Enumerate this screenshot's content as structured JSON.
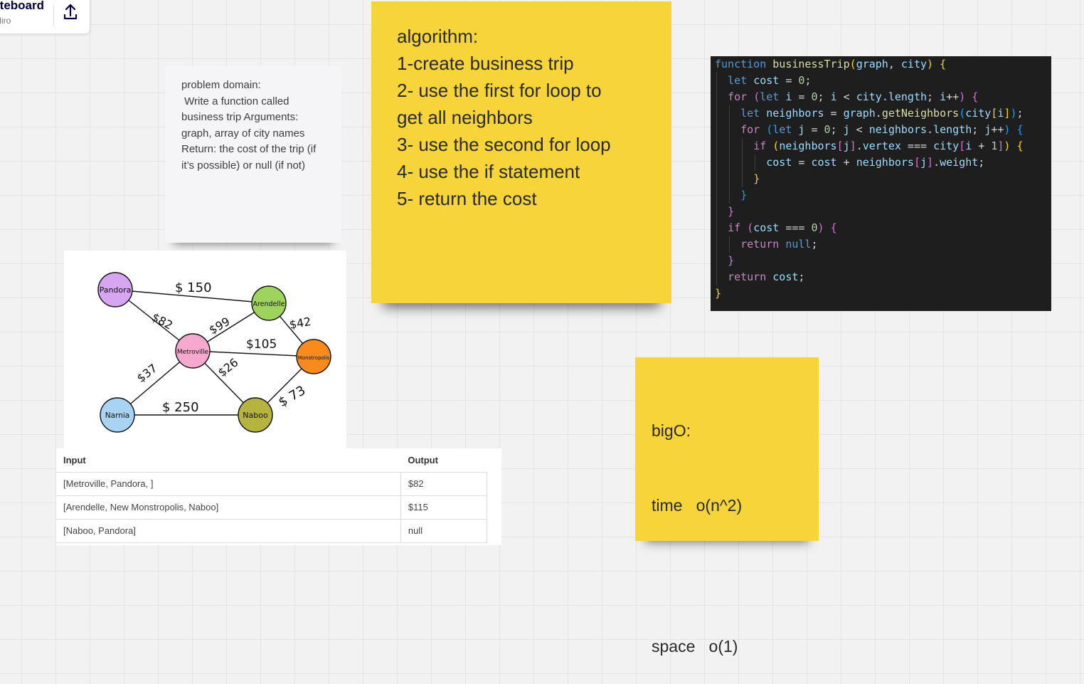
{
  "header": {
    "title": "Whiteboard",
    "subtitle": "Miro"
  },
  "notes": {
    "problem": "problem domain:\n Write a function called business trip Arguments: graph, array of city names\nReturn: the cost of the trip (if it’s possible) or null (if not)",
    "algorithm": [
      "algorithm:",
      "1-create business trip",
      "2- use the first for loop to",
      "get all neighbors",
      "3- use the second for loop",
      "4- use the if statement",
      "5- return the cost"
    ],
    "bigo": [
      "bigO:",
      "time   o(n^2)",
      "",
      "space   o(1)"
    ]
  },
  "graph": {
    "nodes": [
      {
        "id": "pandora",
        "label": "Pandora",
        "color": "#d6a6f2"
      },
      {
        "id": "arendelle",
        "label": "Arendelle",
        "color": "#9ed35d"
      },
      {
        "id": "metroville",
        "label": "Metroville",
        "color": "#f6a8cf"
      },
      {
        "id": "monstropolis",
        "label": "Monstropolis",
        "color": "#f98a1c"
      },
      {
        "id": "narnia",
        "label": "Narnia",
        "color": "#a9d3f3"
      },
      {
        "id": "naboo",
        "label": "Naboo",
        "color": "#b5b440"
      }
    ],
    "edges": [
      {
        "from": "pandora",
        "to": "arendelle",
        "label": "$ 150"
      },
      {
        "from": "pandora",
        "to": "metroville",
        "label": "$82"
      },
      {
        "from": "metroville",
        "to": "arendelle",
        "label": "$99"
      },
      {
        "from": "arendelle",
        "to": "monstropolis",
        "label": "$42"
      },
      {
        "from": "metroville",
        "to": "monstropolis",
        "label": "$105"
      },
      {
        "from": "metroville",
        "to": "narnia",
        "label": "$37"
      },
      {
        "from": "metroville",
        "to": "naboo",
        "label": "$26"
      },
      {
        "from": "narnia",
        "to": "naboo",
        "label": "$ 250"
      },
      {
        "from": "naboo",
        "to": "monstropolis",
        "label": "$ 73"
      }
    ]
  },
  "table": {
    "headers": [
      "Input",
      "Output"
    ],
    "rows": [
      [
        "[Metroville, Pandora, ]",
        "$82"
      ],
      [
        "[Arendelle, New Monstropolis, Naboo]",
        "$115"
      ],
      [
        "[Naboo, Pandora]",
        "null"
      ]
    ]
  },
  "code": {
    "lines": [
      "function businessTrip(graph, city) {",
      "  let cost = 0;",
      "  for (let i = 0; i < city.length; i++) {",
      "    let neighbors = graph.getNeighbors(city[i]);",
      "    for (let j = 0; j < neighbors.length; j++) {",
      "      if (neighbors[j].vertex === city[i + 1]) {",
      "        cost = cost + neighbors[j].weight;",
      "      }",
      "    }",
      "  }",
      "  if (cost === 0) {",
      "    return null;",
      "  }",
      "  return cost;",
      "}"
    ]
  },
  "icons": {
    "upload": "upload-icon"
  }
}
